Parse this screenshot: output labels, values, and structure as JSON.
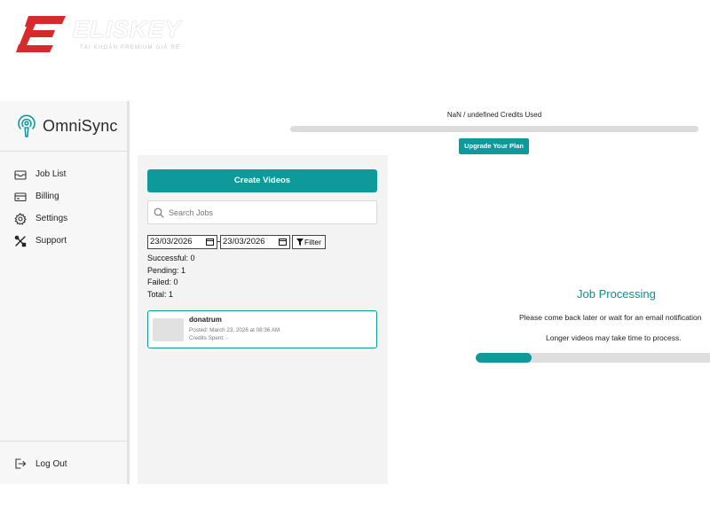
{
  "watermark": {
    "name": "ELISKEY",
    "tagline": "TÀI KHOẢN PREMIUM GIÁ RẺ"
  },
  "brand": {
    "name": "OmniSync",
    "icon": "podcast-icon"
  },
  "nav": [
    {
      "label": "Job List",
      "icon": "inbox-icon"
    },
    {
      "label": "Billing",
      "icon": "credit-card-icon"
    },
    {
      "label": "Settings",
      "icon": "gear-icon"
    },
    {
      "label": "Support",
      "icon": "tools-icon"
    }
  ],
  "logout": {
    "label": "Log Out",
    "icon": "logout-icon"
  },
  "credits": {
    "text": "NaN / undefined Credits Used",
    "used_fraction": 0.0
  },
  "upgrade": {
    "label": "Upgrade Your Plan"
  },
  "jobs": {
    "create_label": "Create Videos",
    "search_placeholder": "Search Jobs",
    "date_from": "23/03/2026",
    "date_to": "23/03/2026",
    "filter_label": "Filter",
    "stats": {
      "successful": "Successful: 0",
      "pending": "Pending: 1",
      "failed": "Failed: 0",
      "total": "Total: 1"
    },
    "items": [
      {
        "title": "donatrum",
        "posted": "Posted: March 23, 2026 at 08:36 AM",
        "credits": "Credits Spent: -"
      }
    ]
  },
  "processing": {
    "title": "Job Processing",
    "message": "Please come back later or wait for an email notification",
    "sub": "Longer videos may take time to process.",
    "progress": 0.24
  },
  "colors": {
    "accent": "#0e9a9a",
    "logo_red": "#d62b2b"
  }
}
